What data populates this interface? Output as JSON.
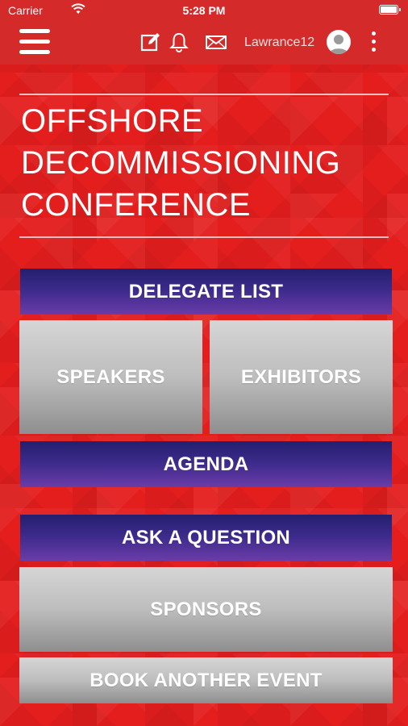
{
  "status_bar": {
    "carrier": "Carrier",
    "time": "5:28 PM"
  },
  "top_bar": {
    "username": "Lawrance12"
  },
  "title": {
    "line1": "OFFSHORE",
    "line2": "DECOMMISSIONING",
    "line3": "CONFERENCE"
  },
  "menu": {
    "delegate_list": "DELEGATE LIST",
    "speakers": "SPEAKERS",
    "exhibitors": "EXHIBITORS",
    "agenda": "AGENDA",
    "ask_question": "ASK A QUESTION",
    "sponsors": "SPONSORS",
    "book_event": "BOOK ANOTHER EVENT"
  },
  "colors": {
    "background": "#e41d1d",
    "header": "#d42a2a",
    "purple_button": "#3b2a8a",
    "grey_button": "#bdbdbd"
  },
  "icons": [
    "hamburger-icon",
    "edit-icon",
    "bell-icon",
    "mail-icon",
    "avatar-icon",
    "more-vertical-icon",
    "wifi-icon",
    "battery-icon"
  ]
}
